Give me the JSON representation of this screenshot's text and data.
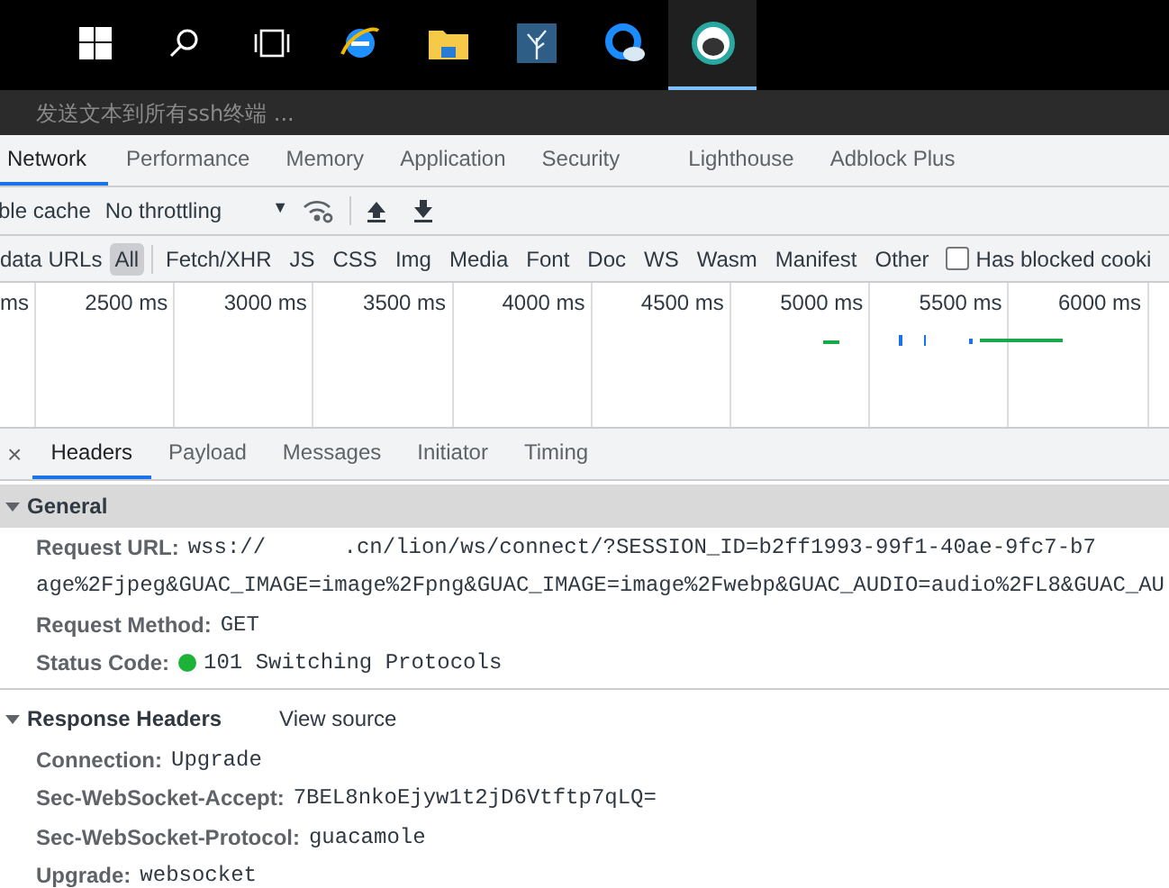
{
  "taskbar": {
    "items": [
      {
        "kind": "start",
        "selected": false
      },
      {
        "kind": "search",
        "selected": false
      },
      {
        "kind": "taskview",
        "selected": false
      },
      {
        "kind": "ie",
        "selected": false
      },
      {
        "kind": "folder",
        "selected": false
      },
      {
        "kind": "tree",
        "selected": false
      },
      {
        "kind": "cloud",
        "selected": false
      },
      {
        "kind": "seal",
        "selected": true
      }
    ]
  },
  "broadcast": {
    "placeholder": "发送文本到所有ssh终端 ..."
  },
  "panel_tabs": [
    {
      "label": "Network",
      "selected": true
    },
    {
      "label": "Performance",
      "selected": false
    },
    {
      "label": "Memory",
      "selected": false
    },
    {
      "label": "Application",
      "selected": false
    },
    {
      "label": "Security",
      "selected": false
    },
    {
      "label": "Lighthouse",
      "selected": false
    },
    {
      "label": "Adblock Plus",
      "selected": false
    }
  ],
  "toolbar": {
    "cache_label": "ble cache",
    "throttling": "No throttling",
    "throttling_caret": "▼"
  },
  "filters": {
    "hide_label": "data URLs",
    "types": [
      {
        "label": "All",
        "selected": true
      },
      {
        "label": "Fetch/XHR",
        "selected": false
      },
      {
        "label": "JS",
        "selected": false
      },
      {
        "label": "CSS",
        "selected": false
      },
      {
        "label": "Img",
        "selected": false
      },
      {
        "label": "Media",
        "selected": false
      },
      {
        "label": "Font",
        "selected": false
      },
      {
        "label": "Doc",
        "selected": false
      },
      {
        "label": "WS",
        "selected": false
      },
      {
        "label": "Wasm",
        "selected": false
      },
      {
        "label": "Manifest",
        "selected": false
      },
      {
        "label": "Other",
        "selected": false
      }
    ],
    "blocked_cookies": {
      "label": "Has blocked cooki",
      "checked": false
    }
  },
  "timeline": {
    "ticks": [
      "ms",
      "2500 ms",
      "3000 ms",
      "3500 ms",
      "4000 ms",
      "4500 ms",
      "5000 ms",
      "5500 ms",
      "6000 ms"
    ]
  },
  "detail_tabs": {
    "close": "×",
    "tabs": [
      {
        "label": "Headers",
        "selected": true
      },
      {
        "label": "Payload",
        "selected": false
      },
      {
        "label": "Messages",
        "selected": false
      },
      {
        "label": "Initiator",
        "selected": false
      },
      {
        "label": "Timing",
        "selected": false
      }
    ]
  },
  "general": {
    "title": "General",
    "expanded": true,
    "rows": [
      {
        "name": "Request URL:",
        "value": "wss://      .cn/lion/ws/connect/?SESSION_ID=b2ff1993-99f1-40ae-9fc7-b7",
        "continuation": "age%2Fjpeg&GUAC_IMAGE=image%2Fpng&GUAC_IMAGE=image%2Fwebp&GUAC_AUDIO=audio%2FL8&GUAC_AU"
      },
      {
        "name": "Request Method:",
        "value": "GET"
      },
      {
        "name": "Status Code:",
        "value": "101 Switching Protocols",
        "color": "#1db33b"
      }
    ]
  },
  "response_headers": {
    "title": "Response Headers",
    "expanded": true,
    "view_source": "View source",
    "rows": [
      {
        "name": "Connection:",
        "value": "Upgrade"
      },
      {
        "name": "Sec-WebSocket-Accept:",
        "value": "7BEL8nkoEjyw1t2jD6Vtftp7qLQ="
      },
      {
        "name": "Sec-WebSocket-Protocol:",
        "value": "guacamole"
      },
      {
        "name": "Upgrade:",
        "value": "websocket"
      }
    ]
  }
}
